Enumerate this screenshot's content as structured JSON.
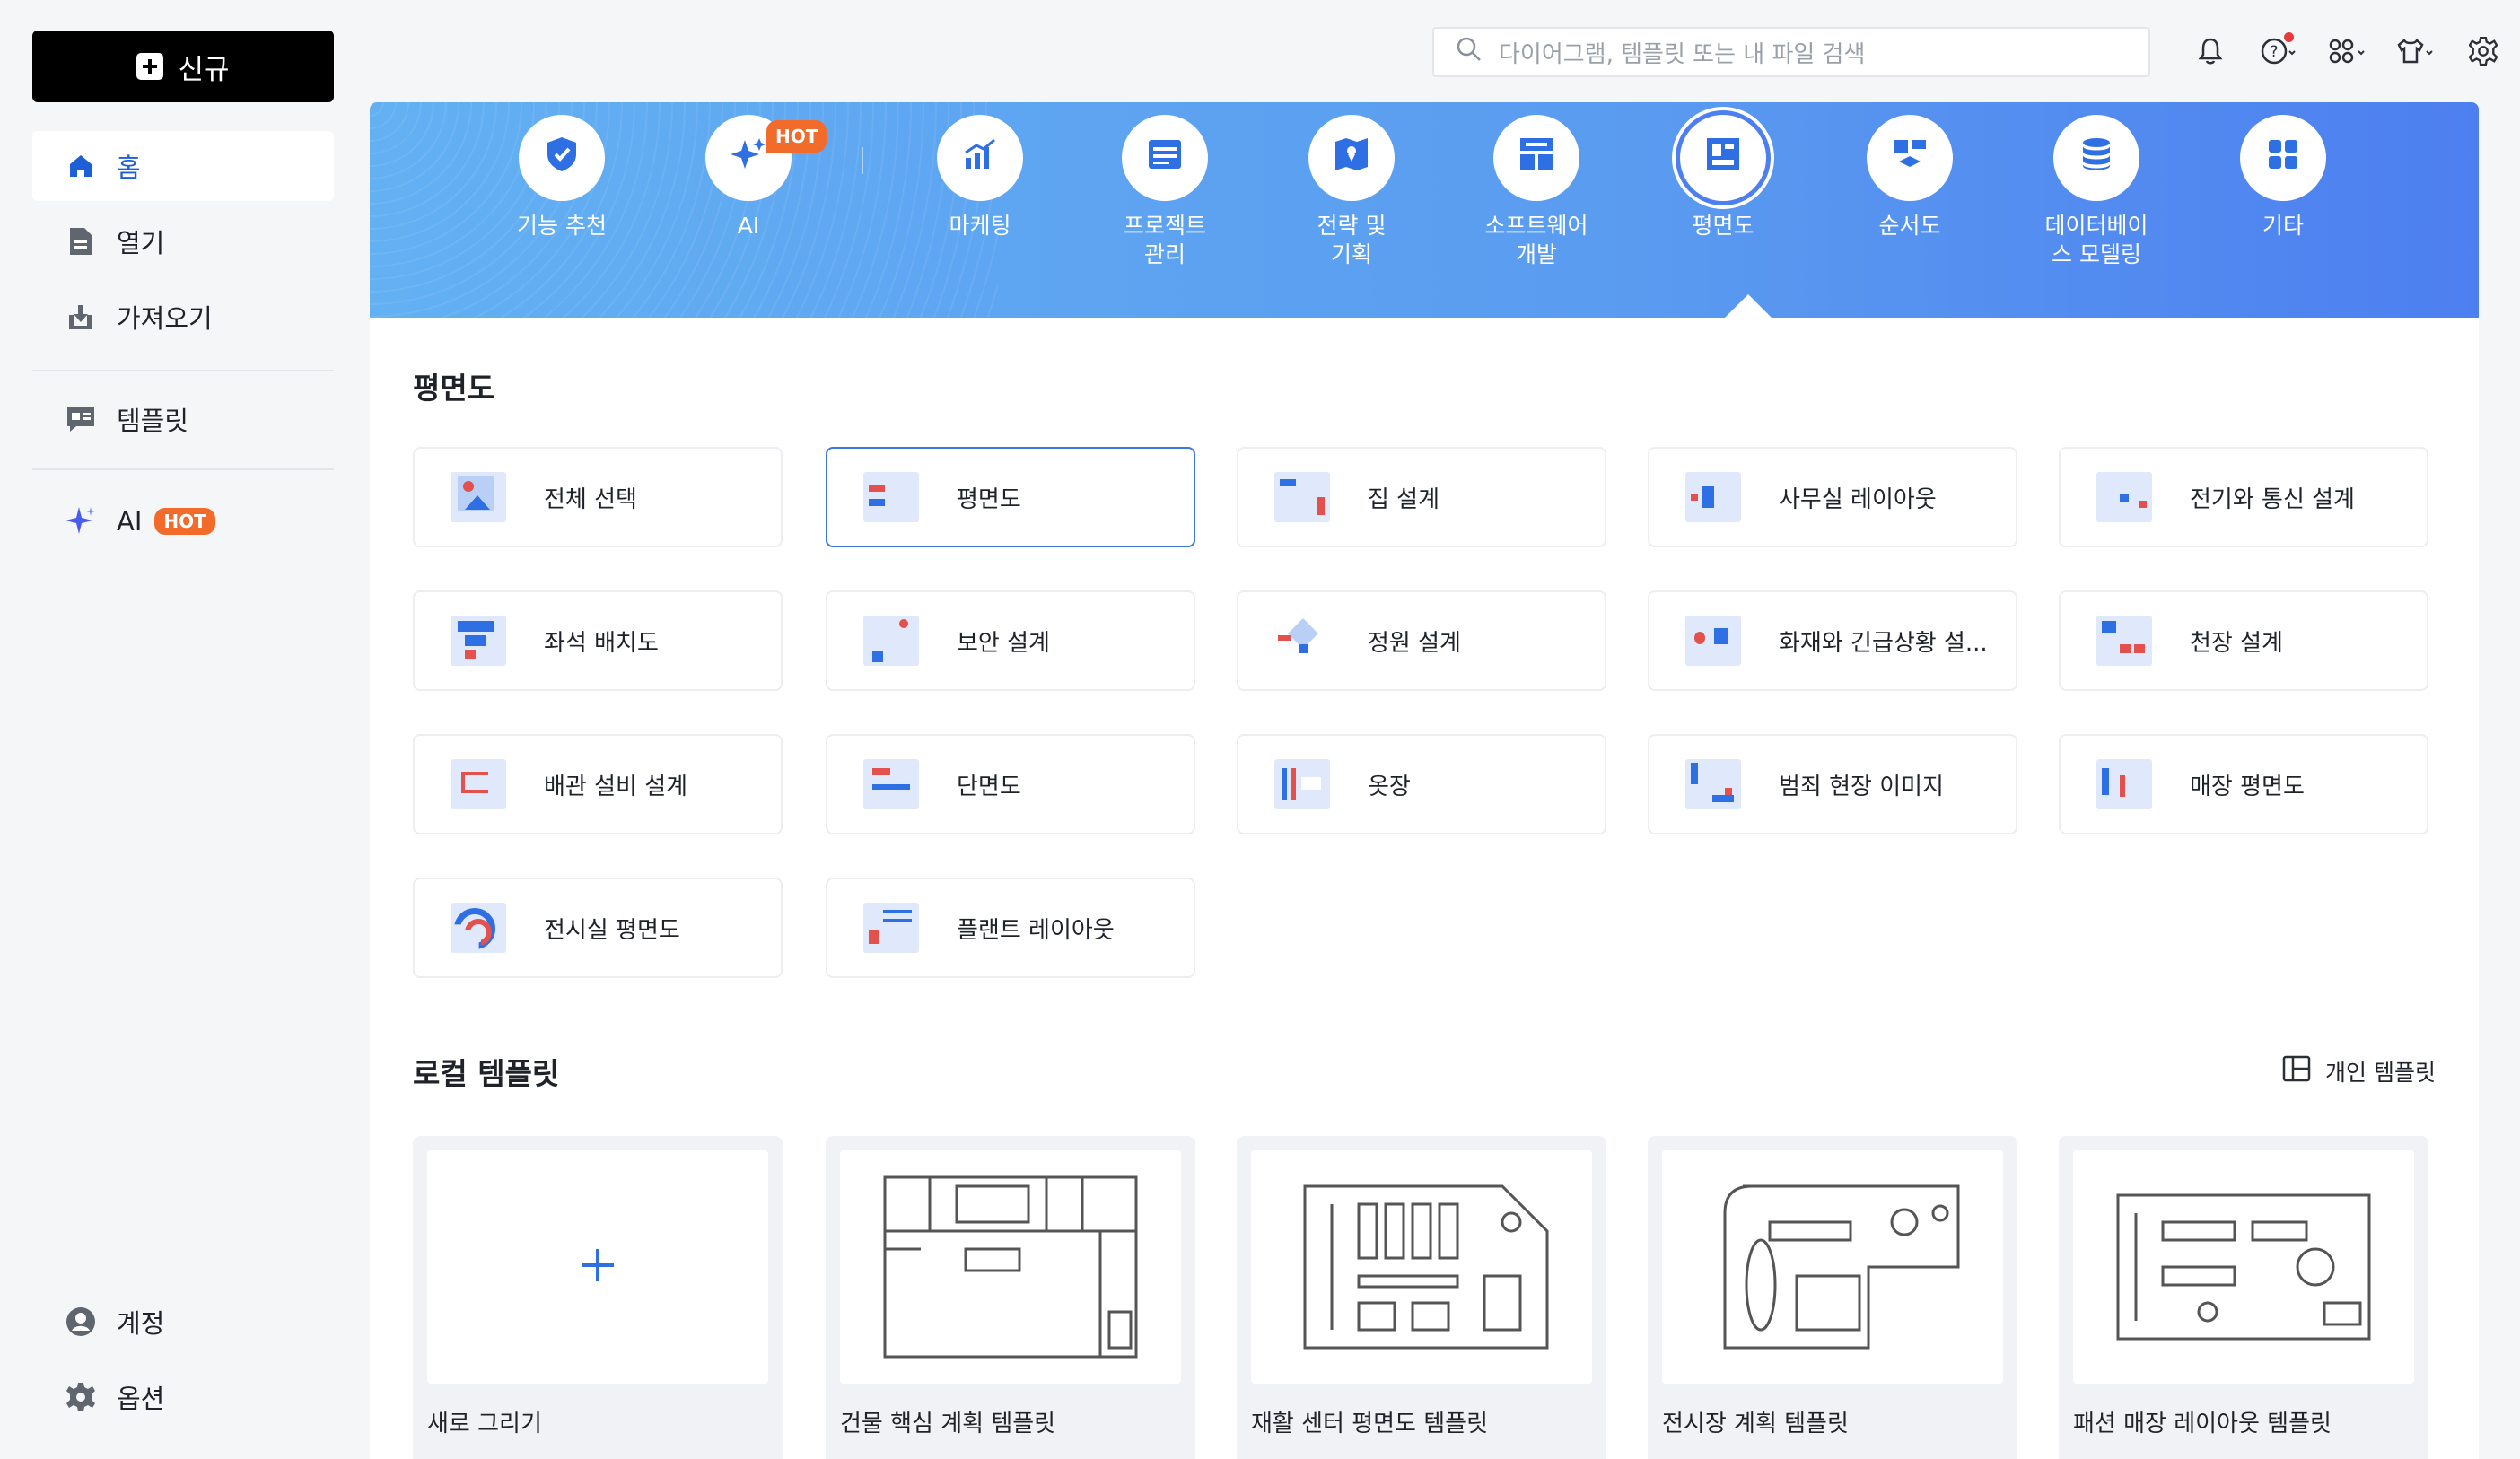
{
  "sidebar": {
    "new_label": "신규",
    "items": [
      {
        "label": "홈",
        "icon": "home-icon"
      },
      {
        "label": "열기",
        "icon": "file-icon"
      },
      {
        "label": "가져오기",
        "icon": "import-icon"
      },
      {
        "label": "템플릿",
        "icon": "template-icon"
      },
      {
        "label": "AI",
        "icon": "sparkle-icon",
        "badge": "HOT"
      }
    ],
    "bottom": [
      {
        "label": "계정",
        "icon": "account-icon"
      },
      {
        "label": "옵션",
        "icon": "gear-icon"
      }
    ]
  },
  "search": {
    "placeholder": "다이어그램, 템플릿 또는 내 파일 검색"
  },
  "categories": [
    {
      "label": "기능 추천",
      "icon": "recommend-icon"
    },
    {
      "label": "AI",
      "icon": "ai-sparkle-icon",
      "badge": "HOT"
    },
    {
      "label": "마케팅",
      "icon": "marketing-chart-icon"
    },
    {
      "label": "프로젝트\n관리",
      "icon": "project-icon"
    },
    {
      "label": "전략 및\n기획",
      "icon": "strategy-map-icon"
    },
    {
      "label": "소프트웨어\n개발",
      "icon": "software-icon"
    },
    {
      "label": "평면도",
      "icon": "floorplan-icon",
      "selected": true
    },
    {
      "label": "순서도",
      "icon": "flowchart-icon"
    },
    {
      "label": "데이터베이\n스 모델링",
      "icon": "database-icon"
    },
    {
      "label": "기타",
      "icon": "grid-icon"
    }
  ],
  "section_title": "평면도",
  "tiles": [
    "전체 선택",
    "평면도",
    "집 설계",
    "사무실 레이아웃",
    "전기와 통신 설계",
    "좌석 배치도",
    "보안 설계",
    "정원 설계",
    "화재와 긴급상황 설...",
    "천장 설계",
    "배관 설비 설계",
    "단면도",
    "옷장",
    "범죄 현장 이미지",
    "매장 평면도",
    "전시실 평면도",
    "플랜트 레이아웃"
  ],
  "local_title": "로컬 템플릿",
  "personal_label": "개인 템플릿",
  "cards": [
    "새로 그리기",
    "건물 핵심 계획 템플릿",
    "재활 센터 평면도 템플릿",
    "전시장 계획 템플릿",
    "패션 매장 레이아웃 템플릿"
  ],
  "colors": {
    "accent": "#3d78e0",
    "hot": "#f26b2b",
    "banner_start": "#63b0f3",
    "banner_end": "#4d7ff0"
  }
}
